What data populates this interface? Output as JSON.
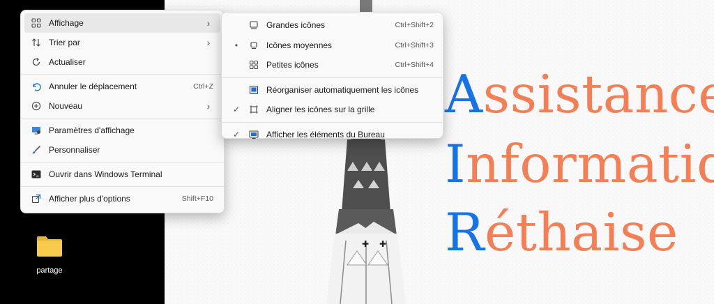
{
  "main_menu": {
    "items": [
      {
        "label": "Affichage",
        "icon": "grid-icon",
        "has_submenu": true
      },
      {
        "label": "Trier par",
        "icon": "sort-icon",
        "has_submenu": true
      },
      {
        "label": "Actualiser",
        "icon": "refresh-icon"
      },
      {
        "label": "Annuler le déplacement",
        "icon": "undo-icon",
        "shortcut": "Ctrl+Z"
      },
      {
        "label": "Nouveau",
        "icon": "new-plus-icon",
        "has_submenu": true
      },
      {
        "label": "Paramètres d'affichage",
        "icon": "display-settings-icon"
      },
      {
        "label": "Personnaliser",
        "icon": "personalize-brush-icon"
      },
      {
        "label": "Ouvrir dans Windows Terminal",
        "icon": "terminal-icon"
      },
      {
        "label": "Afficher plus d'options",
        "icon": "more-options-icon",
        "shortcut": "Shift+F10"
      }
    ]
  },
  "sub_menu": {
    "items": [
      {
        "label": "Grandes icônes",
        "icon": "large-icons-icon",
        "shortcut": "Ctrl+Shift+2"
      },
      {
        "label": "Icônes moyennes",
        "icon": "medium-icons-icon",
        "shortcut": "Ctrl+Shift+3",
        "marker": "•"
      },
      {
        "label": "Petites icônes",
        "icon": "small-icons-icon",
        "shortcut": "Ctrl+Shift+4"
      },
      {
        "label": "Réorganiser automatiquement les icônes",
        "icon": "auto-arrange-icon"
      },
      {
        "label": "Aligner les icônes sur la grille",
        "icon": "align-grid-icon",
        "marker": "✓"
      },
      {
        "label": "Afficher les éléments du Bureau",
        "icon": "show-desktop-icon",
        "marker": "✓"
      }
    ]
  },
  "desktop": {
    "icon_label": "partage"
  },
  "wallpaper": {
    "line1_first": "A",
    "line1_rest": "ssistance",
    "line2_first": "I",
    "line2_rest": "nformatiq",
    "line3_first": "R",
    "line3_rest": "éthaise",
    "colors": {
      "initial": "#1673e8",
      "rest": "#f47f55"
    }
  }
}
